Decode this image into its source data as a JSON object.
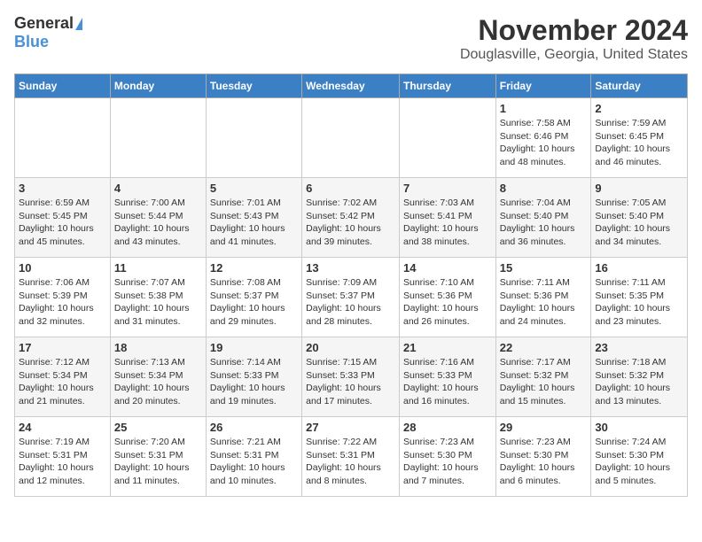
{
  "app": {
    "logo_general": "General",
    "logo_blue": "Blue"
  },
  "header": {
    "month": "November 2024",
    "location": "Douglasville, Georgia, United States"
  },
  "weekdays": [
    "Sunday",
    "Monday",
    "Tuesday",
    "Wednesday",
    "Thursday",
    "Friday",
    "Saturday"
  ],
  "weeks": [
    [
      {
        "day": "",
        "info": ""
      },
      {
        "day": "",
        "info": ""
      },
      {
        "day": "",
        "info": ""
      },
      {
        "day": "",
        "info": ""
      },
      {
        "day": "",
        "info": ""
      },
      {
        "day": "1",
        "info": "Sunrise: 7:58 AM\nSunset: 6:46 PM\nDaylight: 10 hours\nand 48 minutes."
      },
      {
        "day": "2",
        "info": "Sunrise: 7:59 AM\nSunset: 6:45 PM\nDaylight: 10 hours\nand 46 minutes."
      }
    ],
    [
      {
        "day": "3",
        "info": "Sunrise: 6:59 AM\nSunset: 5:45 PM\nDaylight: 10 hours\nand 45 minutes."
      },
      {
        "day": "4",
        "info": "Sunrise: 7:00 AM\nSunset: 5:44 PM\nDaylight: 10 hours\nand 43 minutes."
      },
      {
        "day": "5",
        "info": "Sunrise: 7:01 AM\nSunset: 5:43 PM\nDaylight: 10 hours\nand 41 minutes."
      },
      {
        "day": "6",
        "info": "Sunrise: 7:02 AM\nSunset: 5:42 PM\nDaylight: 10 hours\nand 39 minutes."
      },
      {
        "day": "7",
        "info": "Sunrise: 7:03 AM\nSunset: 5:41 PM\nDaylight: 10 hours\nand 38 minutes."
      },
      {
        "day": "8",
        "info": "Sunrise: 7:04 AM\nSunset: 5:40 PM\nDaylight: 10 hours\nand 36 minutes."
      },
      {
        "day": "9",
        "info": "Sunrise: 7:05 AM\nSunset: 5:40 PM\nDaylight: 10 hours\nand 34 minutes."
      }
    ],
    [
      {
        "day": "10",
        "info": "Sunrise: 7:06 AM\nSunset: 5:39 PM\nDaylight: 10 hours\nand 32 minutes."
      },
      {
        "day": "11",
        "info": "Sunrise: 7:07 AM\nSunset: 5:38 PM\nDaylight: 10 hours\nand 31 minutes."
      },
      {
        "day": "12",
        "info": "Sunrise: 7:08 AM\nSunset: 5:37 PM\nDaylight: 10 hours\nand 29 minutes."
      },
      {
        "day": "13",
        "info": "Sunrise: 7:09 AM\nSunset: 5:37 PM\nDaylight: 10 hours\nand 28 minutes."
      },
      {
        "day": "14",
        "info": "Sunrise: 7:10 AM\nSunset: 5:36 PM\nDaylight: 10 hours\nand 26 minutes."
      },
      {
        "day": "15",
        "info": "Sunrise: 7:11 AM\nSunset: 5:36 PM\nDaylight: 10 hours\nand 24 minutes."
      },
      {
        "day": "16",
        "info": "Sunrise: 7:11 AM\nSunset: 5:35 PM\nDaylight: 10 hours\nand 23 minutes."
      }
    ],
    [
      {
        "day": "17",
        "info": "Sunrise: 7:12 AM\nSunset: 5:34 PM\nDaylight: 10 hours\nand 21 minutes."
      },
      {
        "day": "18",
        "info": "Sunrise: 7:13 AM\nSunset: 5:34 PM\nDaylight: 10 hours\nand 20 minutes."
      },
      {
        "day": "19",
        "info": "Sunrise: 7:14 AM\nSunset: 5:33 PM\nDaylight: 10 hours\nand 19 minutes."
      },
      {
        "day": "20",
        "info": "Sunrise: 7:15 AM\nSunset: 5:33 PM\nDaylight: 10 hours\nand 17 minutes."
      },
      {
        "day": "21",
        "info": "Sunrise: 7:16 AM\nSunset: 5:33 PM\nDaylight: 10 hours\nand 16 minutes."
      },
      {
        "day": "22",
        "info": "Sunrise: 7:17 AM\nSunset: 5:32 PM\nDaylight: 10 hours\nand 15 minutes."
      },
      {
        "day": "23",
        "info": "Sunrise: 7:18 AM\nSunset: 5:32 PM\nDaylight: 10 hours\nand 13 minutes."
      }
    ],
    [
      {
        "day": "24",
        "info": "Sunrise: 7:19 AM\nSunset: 5:31 PM\nDaylight: 10 hours\nand 12 minutes."
      },
      {
        "day": "25",
        "info": "Sunrise: 7:20 AM\nSunset: 5:31 PM\nDaylight: 10 hours\nand 11 minutes."
      },
      {
        "day": "26",
        "info": "Sunrise: 7:21 AM\nSunset: 5:31 PM\nDaylight: 10 hours\nand 10 minutes."
      },
      {
        "day": "27",
        "info": "Sunrise: 7:22 AM\nSunset: 5:31 PM\nDaylight: 10 hours\nand 8 minutes."
      },
      {
        "day": "28",
        "info": "Sunrise: 7:23 AM\nSunset: 5:30 PM\nDaylight: 10 hours\nand 7 minutes."
      },
      {
        "day": "29",
        "info": "Sunrise: 7:23 AM\nSunset: 5:30 PM\nDaylight: 10 hours\nand 6 minutes."
      },
      {
        "day": "30",
        "info": "Sunrise: 7:24 AM\nSunset: 5:30 PM\nDaylight: 10 hours\nand 5 minutes."
      }
    ]
  ]
}
